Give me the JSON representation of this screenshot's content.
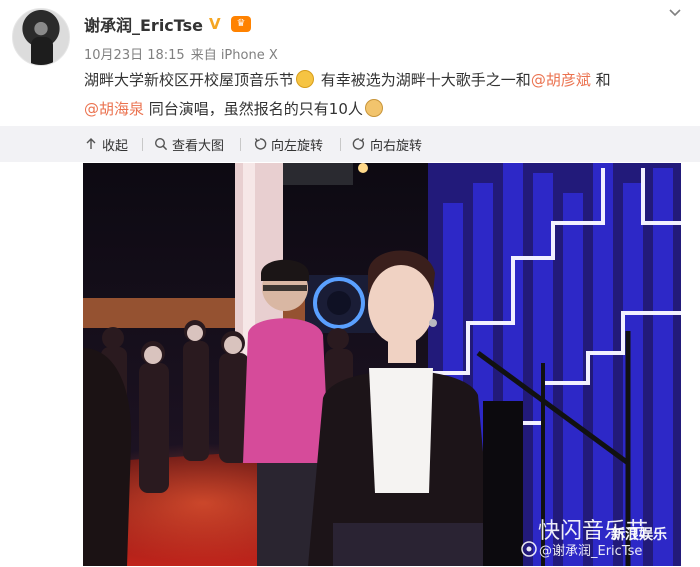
{
  "user": {
    "name": "谢承润_EricTse",
    "verified_icon": "verified-v-icon",
    "vip_icon": "vip-badge-icon"
  },
  "meta": {
    "date": "10月23日 18:15",
    "source": "来自 iPhone X"
  },
  "post": {
    "text_part1": "湖畔大学新校区开校屋顶音乐节",
    "text_part2": "有幸被选为湖畔十大歌手之一和",
    "mention1": "@胡彦斌",
    "text_part3": "和",
    "mention2": "@胡海泉",
    "text_part4": "同台演唱，虽然报名的只有10人",
    "emoji1": "scream-emoji-icon",
    "emoji2": "cat-emoji-icon"
  },
  "toolbar": {
    "collapse": "收起",
    "view_large": "查看大图",
    "rotate_left": "向左旋转",
    "rotate_right": "向右旋转"
  },
  "photo": {
    "calligraphy": "快闪音乐节",
    "watermark_user": "@谢承润_EricTse",
    "watermark_brand": "新浪娱乐"
  },
  "colors": {
    "mention": "#eb7350",
    "toolbar_bg": "#f2f2f5",
    "meta_text": "#808080"
  }
}
